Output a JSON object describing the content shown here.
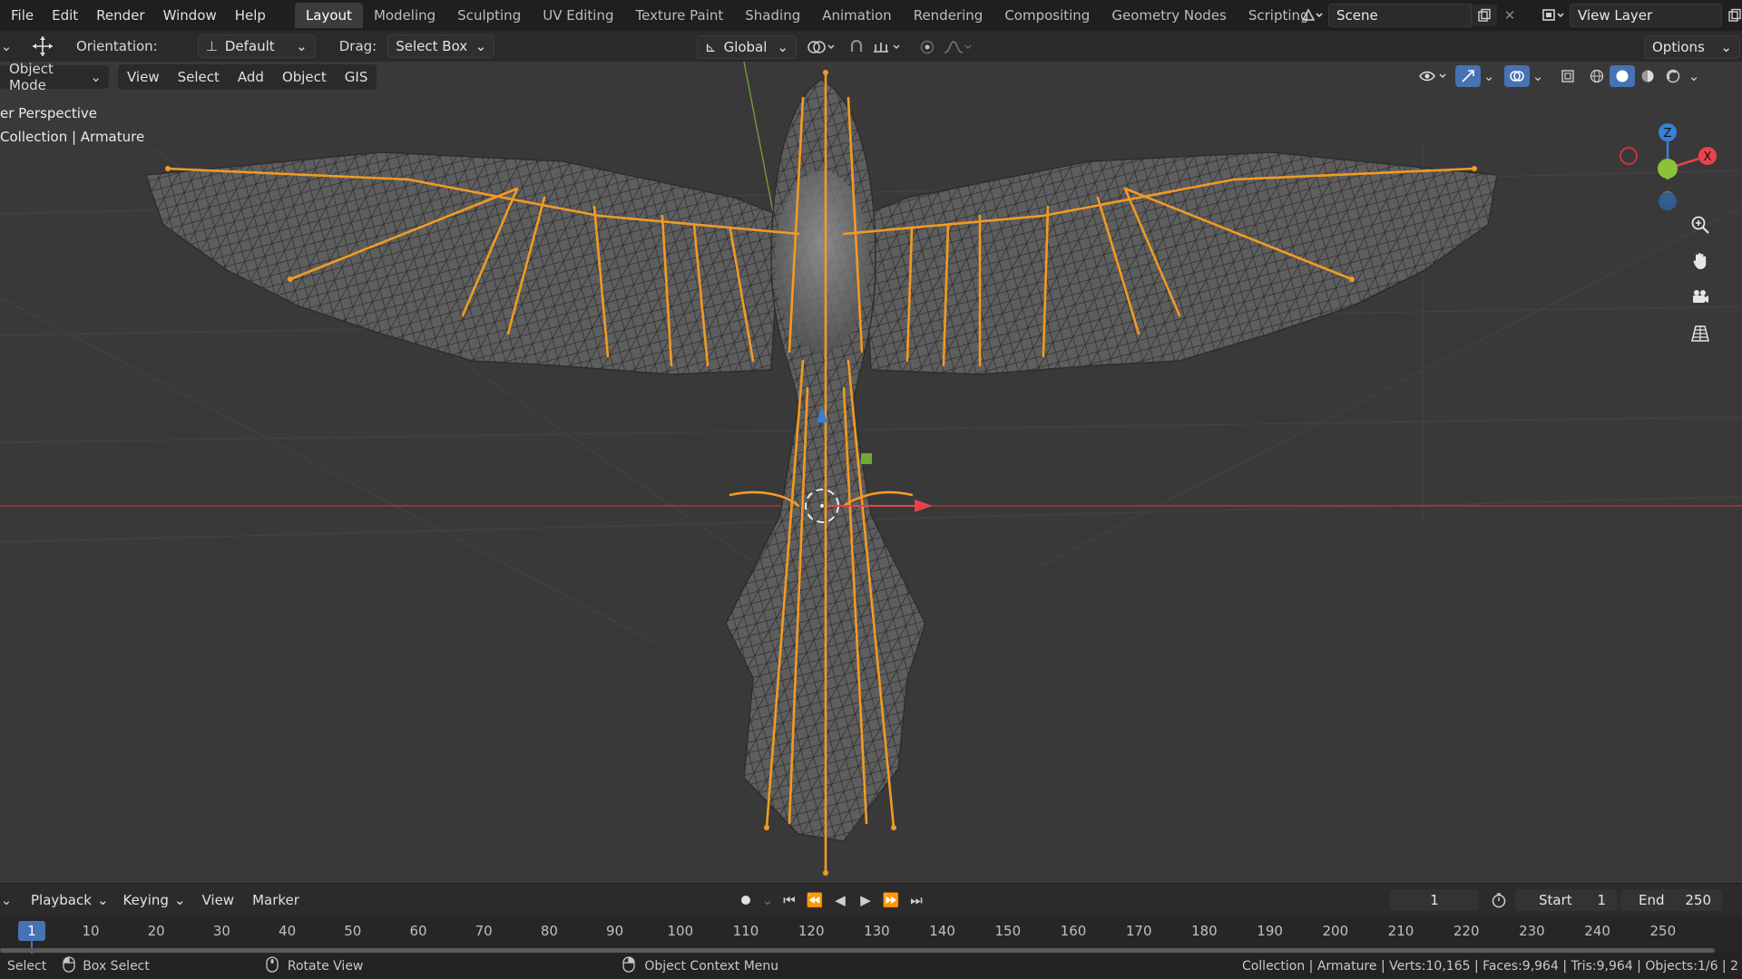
{
  "menu": [
    "File",
    "Edit",
    "Render",
    "Window",
    "Help"
  ],
  "workspace_tabs": [
    "Layout",
    "Modeling",
    "Sculpting",
    "UV Editing",
    "Texture Paint",
    "Shading",
    "Animation",
    "Rendering",
    "Compositing",
    "Geometry Nodes",
    "Scripting"
  ],
  "active_tab": "Layout",
  "scene": {
    "name": "Scene"
  },
  "view_layer": {
    "name": "View Layer"
  },
  "toolbar": {
    "orientation_label": "Orientation:",
    "orientation_value": "Default",
    "drag_label": "Drag:",
    "drag_value": "Select Box",
    "transform_space": "Global",
    "options_label": "Options"
  },
  "viewport_header": {
    "mode": "Object Mode",
    "menus": [
      "View",
      "Select",
      "Add",
      "Object",
      "GIS"
    ]
  },
  "viewport_overlay": {
    "line1": "er Perspective",
    "line2": "Collection | Armature"
  },
  "gizmo": {
    "z": "Z",
    "x": "X"
  },
  "timeline": {
    "menus": [
      "Playback",
      "Keying",
      "View",
      "Marker"
    ],
    "current_frame": "1",
    "start_label": "Start",
    "start_value": "1",
    "end_label": "End",
    "end_value": "250",
    "ruler_current": "1",
    "ticks": [
      "10",
      "20",
      "30",
      "40",
      "50",
      "60",
      "70",
      "80",
      "90",
      "100",
      "110",
      "120",
      "130",
      "140",
      "150",
      "160",
      "170",
      "180",
      "190",
      "200",
      "210",
      "220",
      "230",
      "240",
      "250"
    ]
  },
  "statusbar": {
    "select": "Select",
    "box_select": "Box Select",
    "rotate_view": "Rotate View",
    "context_menu": "Object Context Menu",
    "stats": "Collection | Armature | Verts:10,165 | Faces:9,964 | Tris:9,964 | Objects:1/6 | 2"
  },
  "colors": {
    "bone": "#f39a24",
    "active_tab_bg": "#3c3c3c",
    "axis_x": "#e8434a",
    "axis_y": "#8bc238",
    "axis_z": "#3a7fd6",
    "frame_badge": "#4772b3"
  }
}
